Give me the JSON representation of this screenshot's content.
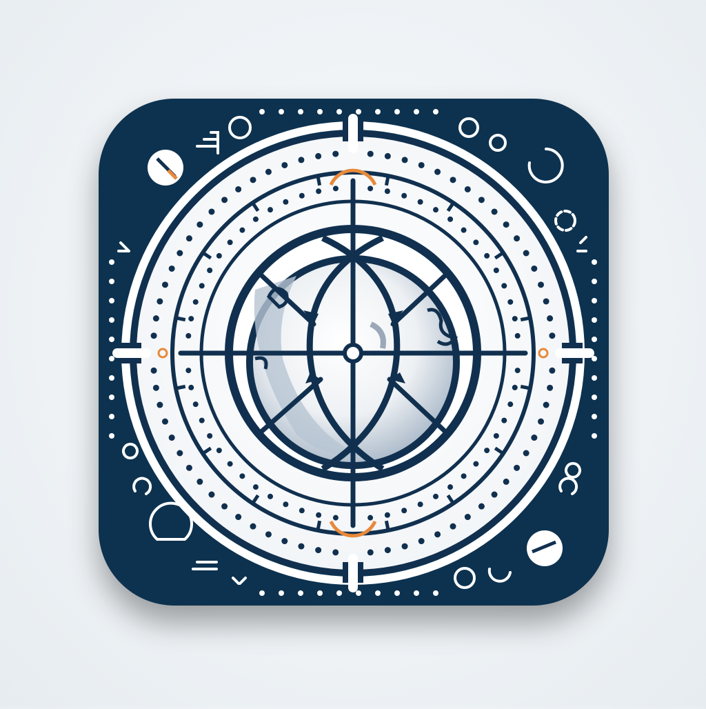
{
  "icon": {
    "description_name": "compass-globe-app-icon",
    "colors": {
      "navy": "#11304f",
      "white": "#ffffff",
      "accent_orange": "#e8893a",
      "globe_shade": "#c9d3de",
      "background": "#eef2f5"
    },
    "symbols": [
      "crosshair",
      "globe",
      "compass-ring",
      "dotted-ring",
      "tick-marks"
    ]
  }
}
